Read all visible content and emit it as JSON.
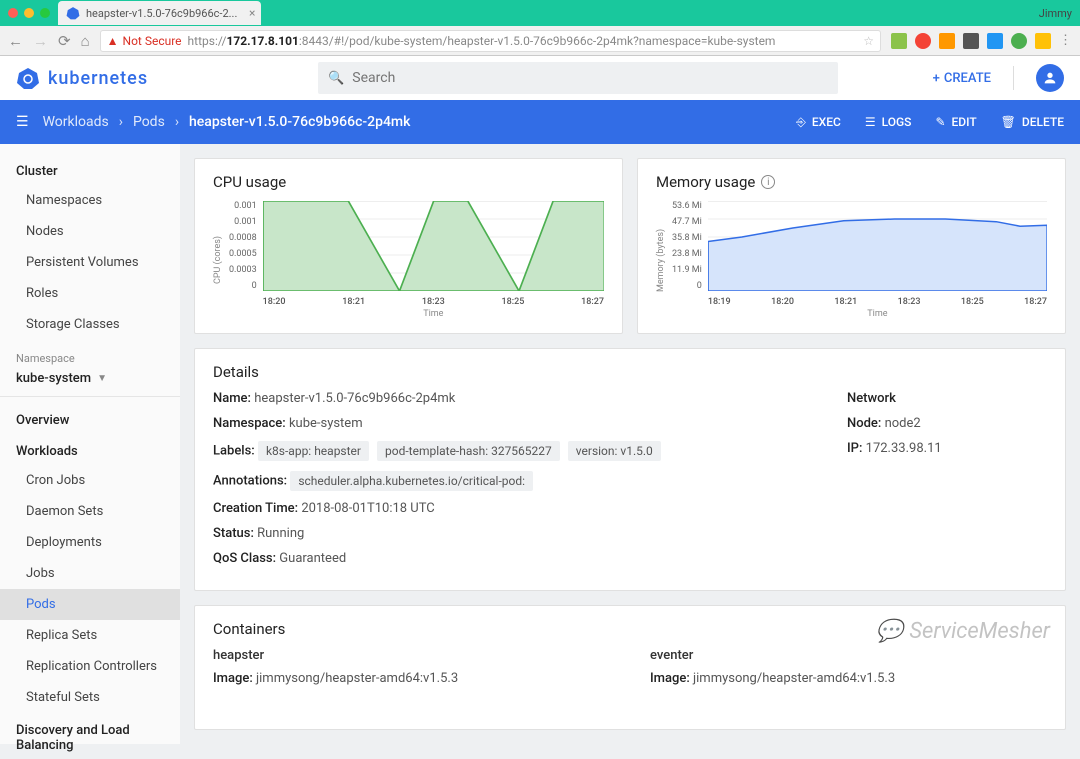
{
  "browser": {
    "tab_title": "heapster-v1.5.0-76c9b966c-2...",
    "user": "Jimmy",
    "not_secure": "Not Secure",
    "url_prefix": "https://",
    "url_host": "172.17.8.101",
    "url_path": ":8443/#!/pod/kube-system/heapster-v1.5.0-76c9b966c-2p4mk?namespace=kube-system"
  },
  "header": {
    "logo": "kubernetes",
    "search_placeholder": "Search",
    "create": "CREATE"
  },
  "breadcrumb": {
    "menu": "☰",
    "item1": "Workloads",
    "item2": "Pods",
    "item3": "heapster-v1.5.0-76c9b966c-2p4mk",
    "actions": {
      "exec": "EXEC",
      "logs": "LOGS",
      "edit": "EDIT",
      "delete": "DELETE"
    }
  },
  "sidebar": {
    "cluster": "Cluster",
    "cluster_items": [
      "Namespaces",
      "Nodes",
      "Persistent Volumes",
      "Roles",
      "Storage Classes"
    ],
    "ns_label": "Namespace",
    "ns_value": "kube-system",
    "overview": "Overview",
    "workloads": "Workloads",
    "workload_items": [
      "Cron Jobs",
      "Daemon Sets",
      "Deployments",
      "Jobs",
      "Pods",
      "Replica Sets",
      "Replication Controllers",
      "Stateful Sets"
    ],
    "discovery": "Discovery and Load Balancing"
  },
  "chart_data": [
    {
      "type": "area",
      "title": "CPU usage",
      "ylabel": "CPU (cores)",
      "xlabel": "Time",
      "y_ticks": [
        "0.001",
        "0.001",
        "0.0008",
        "0.0005",
        "0.0003",
        "0"
      ],
      "x_ticks": [
        "18:20",
        "18:21",
        "18:23",
        "18:25",
        "18:27"
      ],
      "series": [
        {
          "name": "cpu",
          "color": "#4caf50",
          "x": [
            0,
            0.1,
            0.25,
            0.4,
            0.5,
            0.6,
            0.75,
            0.85,
            1.0
          ],
          "y": [
            1,
            1,
            1,
            0,
            1,
            1,
            0,
            1,
            1
          ]
        }
      ],
      "ylim": [
        0,
        0.001
      ]
    },
    {
      "type": "area",
      "title": "Memory usage",
      "ylabel": "Memory (bytes)",
      "xlabel": "Time",
      "y_ticks": [
        "53.6 Mi",
        "47.7 Mi",
        "35.8 Mi",
        "23.8 Mi",
        "11.9 Mi",
        "0"
      ],
      "x_ticks": [
        "18:19",
        "18:20",
        "18:21",
        "18:23",
        "18:25",
        "18:27"
      ],
      "series": [
        {
          "name": "mem",
          "color": "#326de6",
          "x": [
            0,
            0.1,
            0.25,
            0.4,
            0.55,
            0.7,
            0.85,
            0.92,
            1.0
          ],
          "y": [
            0.55,
            0.6,
            0.7,
            0.78,
            0.8,
            0.8,
            0.77,
            0.72,
            0.73
          ]
        }
      ],
      "ylim": [
        0,
        53.6
      ]
    }
  ],
  "details": {
    "title": "Details",
    "name_label": "Name:",
    "name": "heapster-v1.5.0-76c9b966c-2p4mk",
    "namespace_label": "Namespace:",
    "namespace": "kube-system",
    "labels_label": "Labels:",
    "labels": [
      "k8s-app: heapster",
      "pod-template-hash: 327565227",
      "version: v1.5.0"
    ],
    "annotations_label": "Annotations:",
    "annotations": [
      "scheduler.alpha.kubernetes.io/critical-pod:"
    ],
    "creation_label": "Creation Time:",
    "creation": "2018-08-01T10:18 UTC",
    "status_label": "Status:",
    "status": "Running",
    "qos_label": "QoS Class:",
    "qos": "Guaranteed",
    "network": "Network",
    "node_label": "Node:",
    "node": "node2",
    "ip_label": "IP:",
    "ip": "172.33.98.11"
  },
  "containers": {
    "title": "Containers",
    "items": [
      {
        "name": "heapster",
        "image_label": "Image:",
        "image": "jimmysong/heapster-amd64:v1.5.3"
      },
      {
        "name": "eventer",
        "image_label": "Image:",
        "image": "jimmysong/heapster-amd64:v1.5.3"
      }
    ]
  },
  "watermark": "ServiceMesher"
}
